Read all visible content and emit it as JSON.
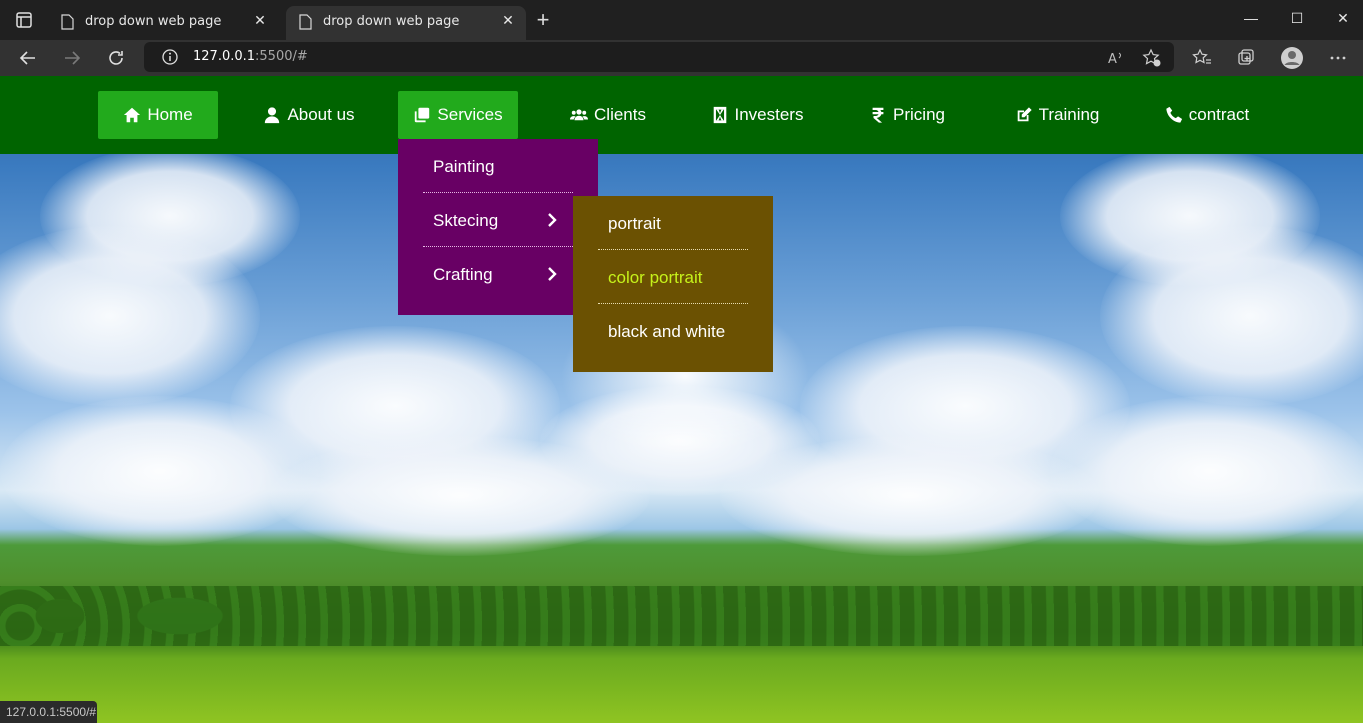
{
  "browser": {
    "tabs": [
      {
        "title": "drop down web page",
        "active": false
      },
      {
        "title": "drop down web page",
        "active": true
      }
    ],
    "url_host": "127.0.0.1",
    "url_path": ":5500/#",
    "status_url": "127.0.0.1:5500/#"
  },
  "nav": {
    "items": [
      {
        "label": "Home",
        "icon": "home-icon",
        "active": true
      },
      {
        "label": "About us",
        "icon": "user-icon",
        "active": false
      },
      {
        "label": "Services",
        "icon": "clone-icon",
        "active": true
      },
      {
        "label": "Clients",
        "icon": "users-icon",
        "active": false
      },
      {
        "label": "Investers",
        "icon": "building-icon",
        "active": false
      },
      {
        "label": "Pricing",
        "icon": "rupee-icon",
        "active": false
      },
      {
        "label": "Training",
        "icon": "edit-icon",
        "active": false
      },
      {
        "label": "contract",
        "icon": "phone-icon",
        "active": false
      }
    ],
    "colors": {
      "bar": "#006400",
      "active": "#22aa1c"
    }
  },
  "services_menu": {
    "items": [
      {
        "label": "Painting",
        "has_submenu": false
      },
      {
        "label": "Sktecing",
        "has_submenu": true
      },
      {
        "label": "Crafting",
        "has_submenu": true
      }
    ],
    "color": "#680064"
  },
  "sketching_submenu": {
    "items": [
      {
        "label": "portrait",
        "hover": false
      },
      {
        "label": "color portrait",
        "hover": true
      },
      {
        "label": "black and white",
        "hover": false
      }
    ],
    "color": "#6b5102",
    "hover_text_color": "#c6f21a"
  }
}
